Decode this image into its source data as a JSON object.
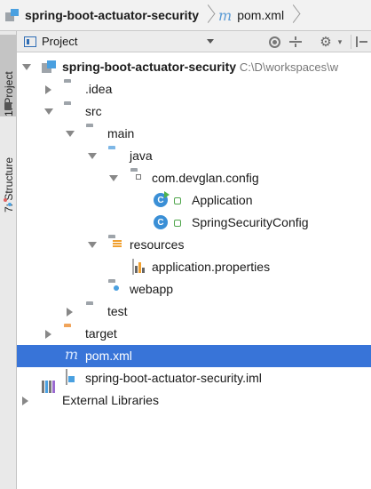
{
  "breadcrumb": {
    "project": "spring-boot-actuator-security",
    "file_icon": "maven-m-icon",
    "file": "pom.xml"
  },
  "panel": {
    "title": "Project",
    "icons": [
      "project-view-icon",
      "locate-icon",
      "collapse-all-icon",
      "gear-icon",
      "hide-panel-icon"
    ]
  },
  "side_tabs": {
    "project": "1: Project",
    "structure": "7: Structure"
  },
  "tree": {
    "root": {
      "label": "spring-boot-actuator-security",
      "path": "C:\\D\\workspaces\\w"
    },
    "idea": ".idea",
    "src": "src",
    "main": "main",
    "java": "java",
    "package": "com.devglan.config",
    "application": "Application",
    "security_config": "SpringSecurityConfig",
    "resources": "resources",
    "properties": "application.properties",
    "webapp": "webapp",
    "test": "test",
    "target": "target",
    "pom": "pom.xml",
    "iml": "spring-boot-actuator-security.iml",
    "external": "External Libraries"
  },
  "colors": {
    "selection": "#3874d8",
    "folder": "#9ea4aa",
    "source_folder": "#7eb7e6",
    "excluded_folder": "#f0a45a",
    "class_icon": "#3a8fd6"
  }
}
